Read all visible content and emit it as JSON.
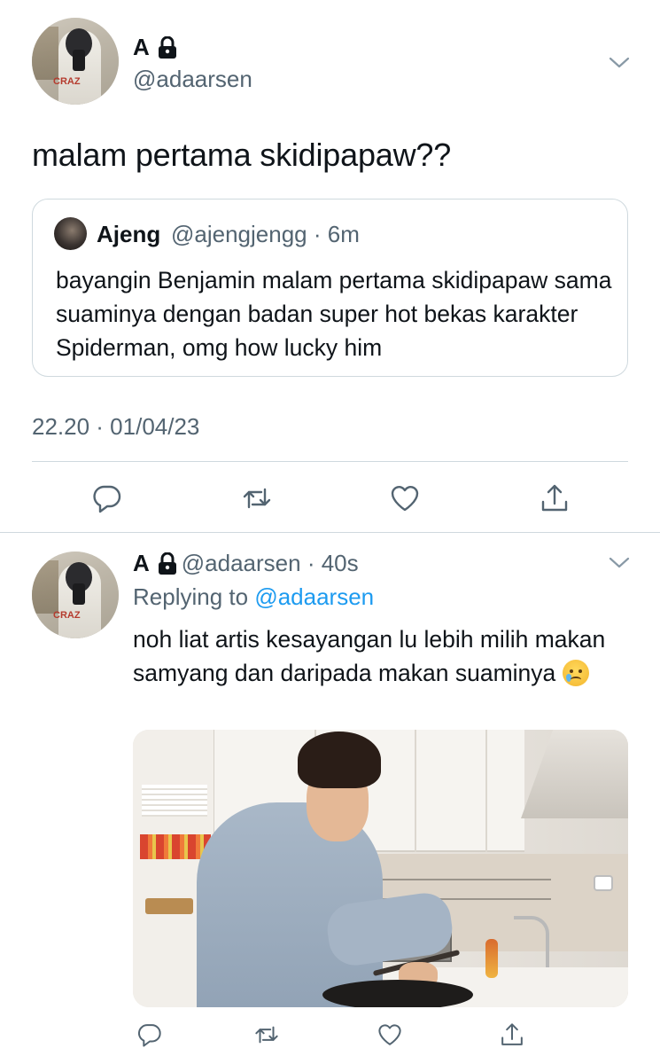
{
  "tweet": {
    "author_name": "A",
    "author_handle": "@adaarsen",
    "text": "malam pertama skidipapaw??",
    "quoted": {
      "author_name": "Ajeng",
      "author_handle_time": "@ajengjengg · 6m",
      "text": "bayangin Benjamin malam pertama skidipapaw sama suaminya dengan badan super hot bekas karakter Spiderman, omg how lucky him"
    },
    "timestamp": "22.20 · 01/04/23",
    "actions": [
      "reply-icon",
      "retweet-icon",
      "like-icon",
      "share-icon"
    ]
  },
  "reply": {
    "author_name": "A",
    "author_handle_time": "@adaarsen · 40s",
    "replying_prefix": "Replying to",
    "replying_to": "@adaarsen",
    "text": "noh liat artis kesayangan lu lebih milih makan samyang dan daripada makan suaminya",
    "emoji": "face-holding-back-tears-emoji",
    "actions": [
      "reply-icon",
      "retweet-icon",
      "like-icon",
      "share-icon"
    ]
  },
  "colors": {
    "text": "#0f1419",
    "secondary": "#536471",
    "link": "#1d9bf0",
    "border": "#cfd9de"
  }
}
